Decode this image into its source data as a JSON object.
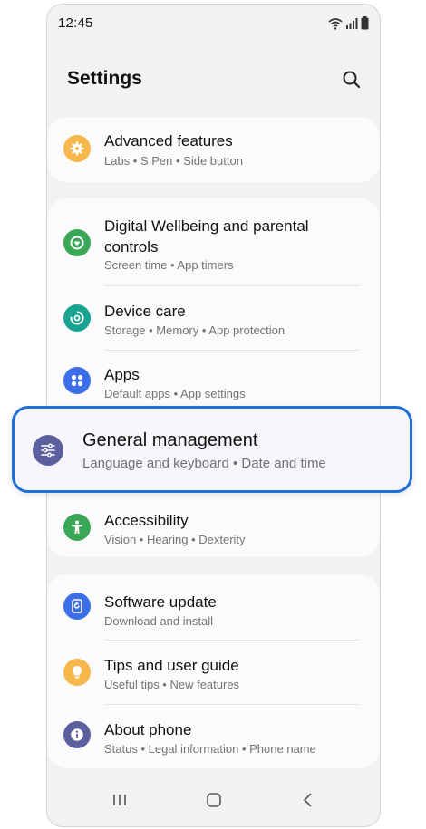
{
  "status": {
    "time": "12:45"
  },
  "header": {
    "title": "Settings"
  },
  "items": [
    {
      "title": "Advanced features",
      "subtitle": "Labs  •  S Pen  •  Side button",
      "icon": "gear-icon",
      "color": "#f7b84b"
    },
    {
      "title": "Digital Wellbeing and parental controls",
      "subtitle": "Screen time  •  App timers",
      "icon": "wellbeing-icon",
      "color": "#3aa757"
    },
    {
      "title": "Device care",
      "subtitle": "Storage  •  Memory  •  App protection",
      "icon": "device-care-icon",
      "color": "#19a391"
    },
    {
      "title": "Apps",
      "subtitle": "Default apps  •  App settings",
      "icon": "apps-icon",
      "color": "#3b6ee8"
    },
    {
      "title": "General management",
      "subtitle": "Language and keyboard  •  Date and time",
      "icon": "sliders-icon",
      "color": "#5c5f9e"
    },
    {
      "title": "Accessibility",
      "subtitle": "Vision  •  Hearing  •  Dexterity",
      "icon": "accessibility-icon",
      "color": "#3aa757"
    },
    {
      "title": "Software update",
      "subtitle": "Download and install",
      "icon": "update-icon",
      "color": "#3b6ee8"
    },
    {
      "title": "Tips and user guide",
      "subtitle": "Useful tips  •  New features",
      "icon": "lightbulb-icon",
      "color": "#f7b84b"
    },
    {
      "title": "About phone",
      "subtitle": "Status  •  Legal information  •  Phone name",
      "icon": "info-icon",
      "color": "#5c5f9e"
    }
  ],
  "highlight_color": "#1f6fd6",
  "nav": [
    "recents-icon",
    "home-icon",
    "back-icon"
  ]
}
